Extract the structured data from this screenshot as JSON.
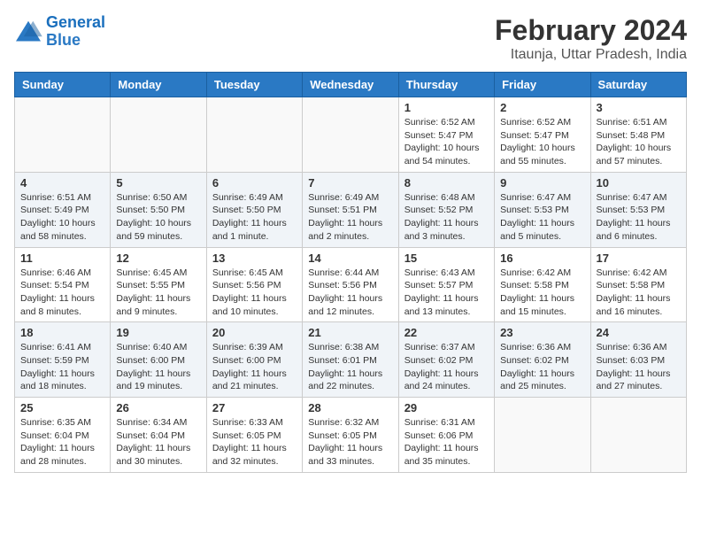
{
  "header": {
    "logo_line1": "General",
    "logo_line2": "Blue",
    "title": "February 2024",
    "subtitle": "Itaunja, Uttar Pradesh, India"
  },
  "weekdays": [
    "Sunday",
    "Monday",
    "Tuesday",
    "Wednesday",
    "Thursday",
    "Friday",
    "Saturday"
  ],
  "weeks": [
    [
      {
        "day": "",
        "info": ""
      },
      {
        "day": "",
        "info": ""
      },
      {
        "day": "",
        "info": ""
      },
      {
        "day": "",
        "info": ""
      },
      {
        "day": "1",
        "info": "Sunrise: 6:52 AM\nSunset: 5:47 PM\nDaylight: 10 hours\nand 54 minutes."
      },
      {
        "day": "2",
        "info": "Sunrise: 6:52 AM\nSunset: 5:47 PM\nDaylight: 10 hours\nand 55 minutes."
      },
      {
        "day": "3",
        "info": "Sunrise: 6:51 AM\nSunset: 5:48 PM\nDaylight: 10 hours\nand 57 minutes."
      }
    ],
    [
      {
        "day": "4",
        "info": "Sunrise: 6:51 AM\nSunset: 5:49 PM\nDaylight: 10 hours\nand 58 minutes."
      },
      {
        "day": "5",
        "info": "Sunrise: 6:50 AM\nSunset: 5:50 PM\nDaylight: 10 hours\nand 59 minutes."
      },
      {
        "day": "6",
        "info": "Sunrise: 6:49 AM\nSunset: 5:50 PM\nDaylight: 11 hours\nand 1 minute."
      },
      {
        "day": "7",
        "info": "Sunrise: 6:49 AM\nSunset: 5:51 PM\nDaylight: 11 hours\nand 2 minutes."
      },
      {
        "day": "8",
        "info": "Sunrise: 6:48 AM\nSunset: 5:52 PM\nDaylight: 11 hours\nand 3 minutes."
      },
      {
        "day": "9",
        "info": "Sunrise: 6:47 AM\nSunset: 5:53 PM\nDaylight: 11 hours\nand 5 minutes."
      },
      {
        "day": "10",
        "info": "Sunrise: 6:47 AM\nSunset: 5:53 PM\nDaylight: 11 hours\nand 6 minutes."
      }
    ],
    [
      {
        "day": "11",
        "info": "Sunrise: 6:46 AM\nSunset: 5:54 PM\nDaylight: 11 hours\nand 8 minutes."
      },
      {
        "day": "12",
        "info": "Sunrise: 6:45 AM\nSunset: 5:55 PM\nDaylight: 11 hours\nand 9 minutes."
      },
      {
        "day": "13",
        "info": "Sunrise: 6:45 AM\nSunset: 5:56 PM\nDaylight: 11 hours\nand 10 minutes."
      },
      {
        "day": "14",
        "info": "Sunrise: 6:44 AM\nSunset: 5:56 PM\nDaylight: 11 hours\nand 12 minutes."
      },
      {
        "day": "15",
        "info": "Sunrise: 6:43 AM\nSunset: 5:57 PM\nDaylight: 11 hours\nand 13 minutes."
      },
      {
        "day": "16",
        "info": "Sunrise: 6:42 AM\nSunset: 5:58 PM\nDaylight: 11 hours\nand 15 minutes."
      },
      {
        "day": "17",
        "info": "Sunrise: 6:42 AM\nSunset: 5:58 PM\nDaylight: 11 hours\nand 16 minutes."
      }
    ],
    [
      {
        "day": "18",
        "info": "Sunrise: 6:41 AM\nSunset: 5:59 PM\nDaylight: 11 hours\nand 18 minutes."
      },
      {
        "day": "19",
        "info": "Sunrise: 6:40 AM\nSunset: 6:00 PM\nDaylight: 11 hours\nand 19 minutes."
      },
      {
        "day": "20",
        "info": "Sunrise: 6:39 AM\nSunset: 6:00 PM\nDaylight: 11 hours\nand 21 minutes."
      },
      {
        "day": "21",
        "info": "Sunrise: 6:38 AM\nSunset: 6:01 PM\nDaylight: 11 hours\nand 22 minutes."
      },
      {
        "day": "22",
        "info": "Sunrise: 6:37 AM\nSunset: 6:02 PM\nDaylight: 11 hours\nand 24 minutes."
      },
      {
        "day": "23",
        "info": "Sunrise: 6:36 AM\nSunset: 6:02 PM\nDaylight: 11 hours\nand 25 minutes."
      },
      {
        "day": "24",
        "info": "Sunrise: 6:36 AM\nSunset: 6:03 PM\nDaylight: 11 hours\nand 27 minutes."
      }
    ],
    [
      {
        "day": "25",
        "info": "Sunrise: 6:35 AM\nSunset: 6:04 PM\nDaylight: 11 hours\nand 28 minutes."
      },
      {
        "day": "26",
        "info": "Sunrise: 6:34 AM\nSunset: 6:04 PM\nDaylight: 11 hours\nand 30 minutes."
      },
      {
        "day": "27",
        "info": "Sunrise: 6:33 AM\nSunset: 6:05 PM\nDaylight: 11 hours\nand 32 minutes."
      },
      {
        "day": "28",
        "info": "Sunrise: 6:32 AM\nSunset: 6:05 PM\nDaylight: 11 hours\nand 33 minutes."
      },
      {
        "day": "29",
        "info": "Sunrise: 6:31 AM\nSunset: 6:06 PM\nDaylight: 11 hours\nand 35 minutes."
      },
      {
        "day": "",
        "info": ""
      },
      {
        "day": "",
        "info": ""
      }
    ]
  ]
}
